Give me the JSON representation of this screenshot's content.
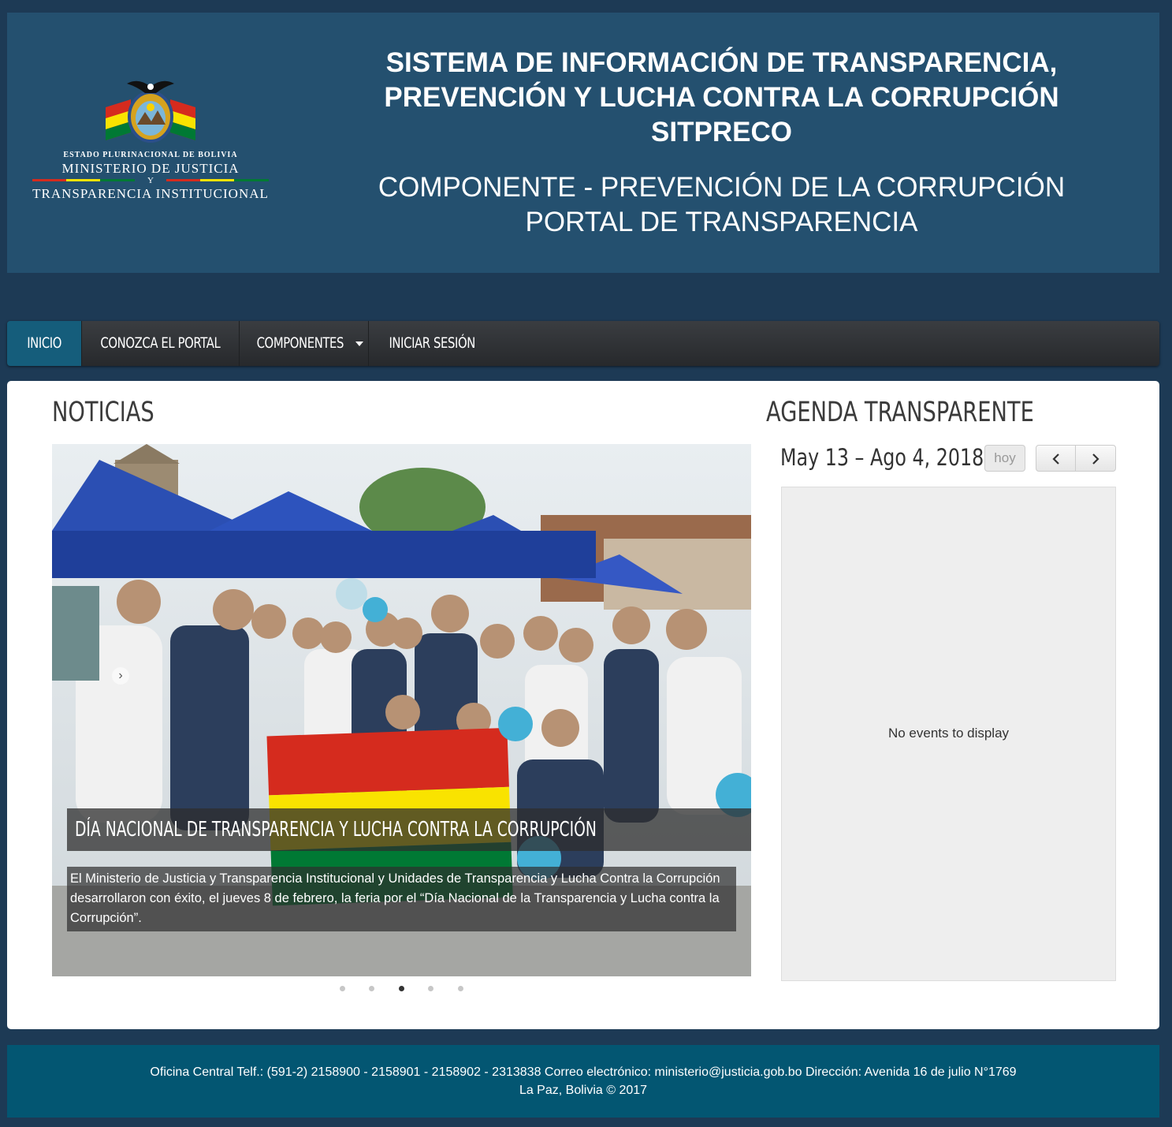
{
  "header": {
    "logo": {
      "line1": "ESTADO PLURINACIONAL DE BOLIVIA",
      "line2": "MINISTERIO DE JUSTICIA",
      "line3": "Y",
      "line4": "TRANSPARENCIA INSTITUCIONAL"
    },
    "title_lines": [
      "SISTEMA DE INFORMACIÓN DE TRANSPARENCIA,",
      "PREVENCIÓN Y LUCHA CONTRA LA CORRUPCIÓN",
      "SITPRECO"
    ],
    "subtitle_lines": [
      "COMPONENTE - PREVENCIÓN DE LA CORRUPCIÓN",
      "PORTAL DE TRANSPARENCIA"
    ]
  },
  "nav": {
    "items": [
      {
        "label": "INICIO",
        "active": true
      },
      {
        "label": "CONOZCA EL PORTAL"
      },
      {
        "label": "COMPONENTES"
      },
      {
        "label": "INICIAR SESIÓN"
      }
    ]
  },
  "news": {
    "heading": "NOTICIAS",
    "slide_title": "DÍA NACIONAL DE TRANSPARENCIA Y LUCHA CONTRA LA CORRUPCIÓN",
    "slide_text": "El Ministerio de Justicia y Transparencia Institucional y Unidades de Transparencia y Lucha Contra la Corrupción desarrollaron con éxito, el jueves 8 de febrero, la feria por el “Día Nacional de la Transparencia y Lucha contra la Corrupción”.",
    "slide_count": 5,
    "active_slide": 3,
    "prev_icon": "chevron-left-icon"
  },
  "agenda": {
    "heading": "AGENDA TRANSPARENTE",
    "range": "May 13 – Ago 4, 2018",
    "today_button": "hoy",
    "prev_button": "‹",
    "next_button": "›",
    "empty_message": "No events to display"
  },
  "footer": {
    "line1": "Oficina Central Telf.: (591-2) 2158900 - 2158901 - 2158902 - 2313838 Correo electrónico: ministerio@justicia.gob.bo Dirección: Avenida 16 de julio N°1769",
    "line2": "La Paz, Bolivia © 2017"
  },
  "colors": {
    "background": "#1d3a55",
    "header": "#24506f",
    "nav_active": "#155d7b",
    "footer": "#035672"
  }
}
